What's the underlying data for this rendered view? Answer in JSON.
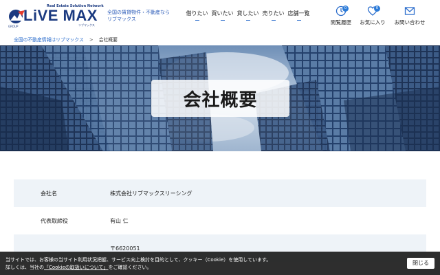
{
  "logo": {
    "tagline": "Real Estate Solution Network",
    "main": "LiVE MAX",
    "kana": "リブマックス",
    "group": "GROUP",
    "mark": "LiVE MAX",
    "colors": {
      "brand": "#1b3a80",
      "accent": "#2b6dcc"
    }
  },
  "header": {
    "sub_line1": "全国の賃貸物件・不動産なら",
    "sub_line2": "リブマックス"
  },
  "nav": [
    {
      "label": "借りたい"
    },
    {
      "label": "買いたい"
    },
    {
      "label": "貸したい"
    },
    {
      "label": "売りたい"
    },
    {
      "label": "店舗一覧"
    }
  ],
  "utility": {
    "history": {
      "label": "閲覧履歴",
      "count": "0",
      "icon": "clock-icon"
    },
    "favorites": {
      "label": "お気に入り",
      "count": "0",
      "icon": "heart-icon"
    },
    "contact": {
      "label": "お問い合わせ",
      "icon": "mail-icon"
    }
  },
  "breadcrumb": {
    "home": "全国の不動産情報はリブマックス",
    "separator": ">",
    "current": "会社概要"
  },
  "hero": {
    "title": "会社概要"
  },
  "company": {
    "rows": [
      {
        "key": "会社名",
        "value": "株式会社リブマックスリーシング"
      },
      {
        "key": "代表取締役",
        "value": "有山 仁"
      },
      {
        "key": "",
        "value": "〒6620051"
      }
    ]
  },
  "cookie": {
    "line1": "当サイトでは、お客様の当サイト利用状況把握、サービス向上検討を目的として、クッキー（Cookie）を使用しています。",
    "line2_pre": "詳しくは、当社の",
    "link": "「Cookieの取扱いについて」",
    "line2_post": "をご確認ください。",
    "close_label": "閉じる"
  }
}
